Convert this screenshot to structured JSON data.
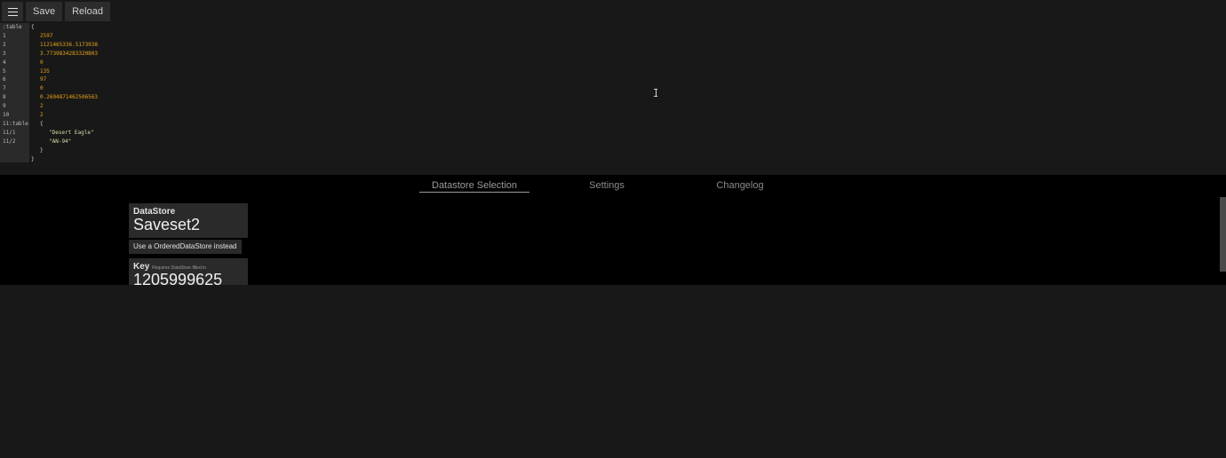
{
  "toolbar": {
    "save_label": "Save",
    "reload_label": "Reload"
  },
  "editor": {
    "gutter_lines": [
      ":table",
      "1",
      "2",
      "3",
      "4",
      "5",
      "6",
      "7",
      "8",
      "9",
      "10",
      "11:table",
      "11/1",
      "11/2"
    ],
    "code_lines": [
      {
        "text": "{",
        "kind": "brace",
        "indent": 0
      },
      {
        "text": "2597",
        "kind": "num",
        "indent": 1
      },
      {
        "text": "1121465336.5173938",
        "kind": "num",
        "indent": 1
      },
      {
        "text": "3.7739834283320803",
        "kind": "num",
        "indent": 1
      },
      {
        "text": "0",
        "kind": "num",
        "indent": 1
      },
      {
        "text": "135",
        "kind": "num",
        "indent": 1
      },
      {
        "text": "97",
        "kind": "num",
        "indent": 1
      },
      {
        "text": "0",
        "kind": "num",
        "indent": 1
      },
      {
        "text": "0.2694871462506563",
        "kind": "num",
        "indent": 1
      },
      {
        "text": "2",
        "kind": "num",
        "indent": 1
      },
      {
        "text": "2",
        "kind": "num",
        "indent": 1
      },
      {
        "text": "{",
        "kind": "brace",
        "indent": 1
      },
      {
        "text": "\"Desert Eagle\"",
        "kind": "str",
        "indent": 2
      },
      {
        "text": "\"AN-94\"",
        "kind": "str",
        "indent": 2
      },
      {
        "text": "}",
        "kind": "brace",
        "indent": 1
      },
      {
        "text": "}",
        "kind": "brace",
        "indent": 0
      }
    ]
  },
  "tabs": [
    {
      "label": "Datastore Selection",
      "active": true
    },
    {
      "label": "Settings",
      "active": false
    },
    {
      "label": "Changelog",
      "active": false
    }
  ],
  "datastore": {
    "label": "DataStore",
    "value": "Saveset2",
    "ordered_button": "Use a OrderedDataStore instead"
  },
  "key": {
    "label": "Key",
    "hint": "Requires DataStore filled in",
    "value": "1205999625"
  }
}
